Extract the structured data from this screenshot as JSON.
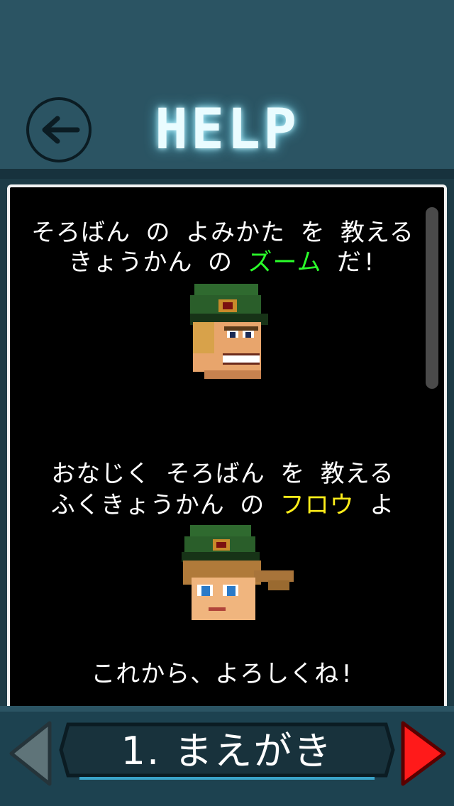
{
  "header": {
    "title": "HELP",
    "back_icon": "arrow-left-icon"
  },
  "dialogue": {
    "intro_line1": "そろばん の よみかた を 教える",
    "intro_line2_a": "きょうかん の ",
    "intro_line2_name": "ズーム",
    "intro_line2_b": " だ!",
    "second_line1": "おなじく そろばん を 教える",
    "second_line2_a": "ふくきょうかん の ",
    "second_line2_name": "フロウ",
    "second_line2_b": " よ",
    "closing": "これから、よろしくね!"
  },
  "footer": {
    "chapter_label": "1. まえがき",
    "prev_icon": "triangle-left-icon",
    "next_icon": "triangle-right-icon"
  },
  "colors": {
    "background": "#2b5463",
    "title_glow": "#6fd8f0",
    "name_green": "#2bff2b",
    "name_yellow": "#ffee1a",
    "next_arrow": "#ff1a1a"
  }
}
